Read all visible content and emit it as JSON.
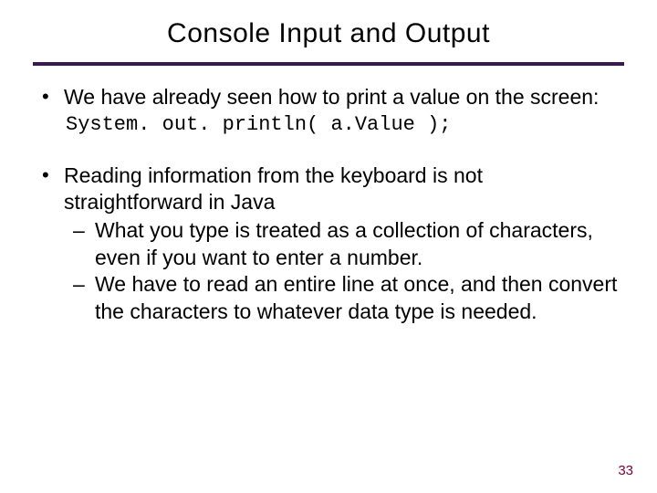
{
  "title": "Console Input and Output",
  "bullet1_text": "We have already seen how to print a value on the screen:",
  "code_line": "System. out. println( a.Value );",
  "bullet2_text": "Reading information from the keyboard is not straightforward in Java",
  "sub1": "What you type is treated as a collection of characters, even if you want to enter a number.",
  "sub2": "We have to read an entire line at once, and then convert the characters to whatever data type is needed.",
  "page_number": "33"
}
